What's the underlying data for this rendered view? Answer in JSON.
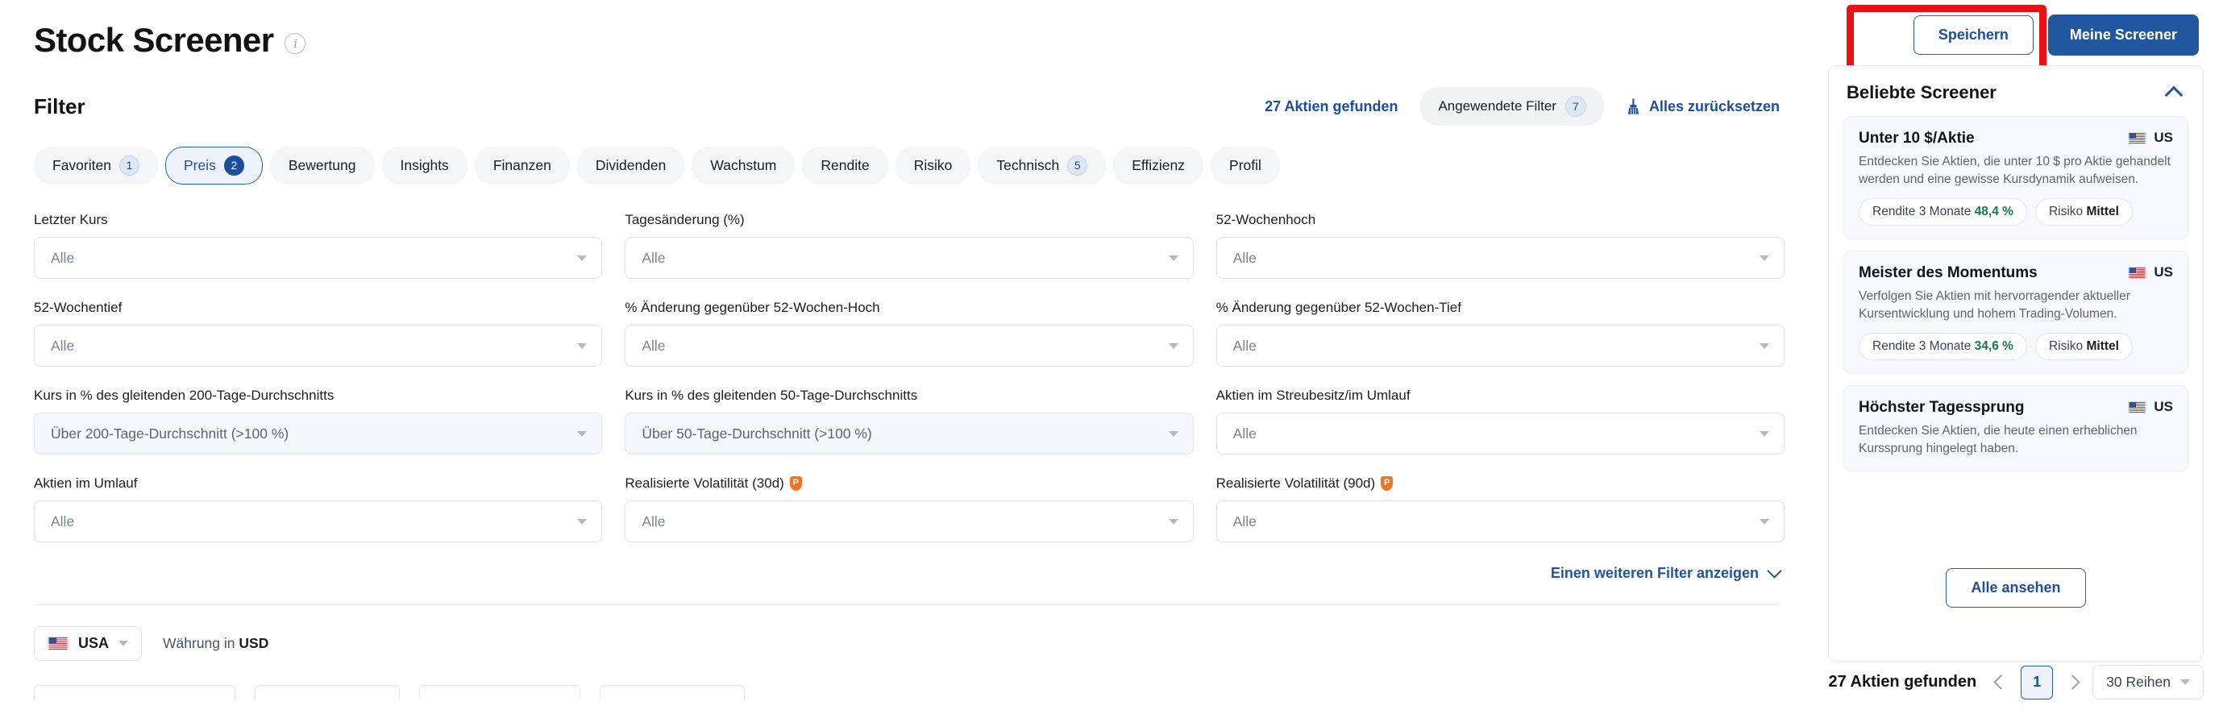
{
  "header": {
    "title": "Stock Screener",
    "info_icon": "info-icon"
  },
  "toolbar": {
    "filter_label": "Filter",
    "found_count": "27 Aktien gefunden",
    "applied_filters_label": "Angewendete Filter",
    "applied_filters_count": "7",
    "reset_label": "Alles zurücksetzen",
    "reset_icon": "broom-icon"
  },
  "tabs": [
    {
      "label": "Favoriten",
      "badge": "1",
      "active": false
    },
    {
      "label": "Preis",
      "badge": "2",
      "active": true
    },
    {
      "label": "Bewertung",
      "badge": "",
      "active": false
    },
    {
      "label": "Insights",
      "badge": "",
      "active": false
    },
    {
      "label": "Finanzen",
      "badge": "",
      "active": false
    },
    {
      "label": "Dividenden",
      "badge": "",
      "active": false
    },
    {
      "label": "Wachstum",
      "badge": "",
      "active": false
    },
    {
      "label": "Rendite",
      "badge": "",
      "active": false
    },
    {
      "label": "Risiko",
      "badge": "",
      "active": false
    },
    {
      "label": "Technisch",
      "badge": "5",
      "active": false
    },
    {
      "label": "Effizienz",
      "badge": "",
      "active": false
    },
    {
      "label": "Profil",
      "badge": "",
      "active": false
    }
  ],
  "filters": [
    {
      "label": "Letzter Kurs",
      "value": "Alle",
      "filled": false,
      "pro": false
    },
    {
      "label": "Tagesänderung (%)",
      "value": "Alle",
      "filled": false,
      "pro": false
    },
    {
      "label": "52-Wochenhoch",
      "value": "Alle",
      "filled": false,
      "pro": false
    },
    {
      "label": "52-Wochentief",
      "value": "Alle",
      "filled": false,
      "pro": false
    },
    {
      "label": "% Änderung gegenüber 52-Wochen-Hoch",
      "value": "Alle",
      "filled": false,
      "pro": false
    },
    {
      "label": "% Änderung gegenüber 52-Wochen-Tief",
      "value": "Alle",
      "filled": false,
      "pro": false
    },
    {
      "label": "Kurs in % des gleitenden 200-Tage-Durchschnitts",
      "value": "Über 200-Tage-Durchschnitt (>100 %)",
      "filled": true,
      "pro": false
    },
    {
      "label": "Kurs in % des gleitenden 50-Tage-Durchschnitts",
      "value": "Über 50-Tage-Durchschnitt (>100 %)",
      "filled": true,
      "pro": false
    },
    {
      "label": "Aktien im Streubesitz/im Umlauf",
      "value": "Alle",
      "filled": false,
      "pro": false
    },
    {
      "label": "Aktien im Umlauf",
      "value": "Alle",
      "filled": false,
      "pro": false
    },
    {
      "label": "Realisierte Volatilität (30d)",
      "value": "Alle",
      "filled": false,
      "pro": true
    },
    {
      "label": "Realisierte Volatilität (90d)",
      "value": "Alle",
      "filled": false,
      "pro": true
    }
  ],
  "show_more": {
    "label": "Einen weiteren Filter anzeigen",
    "icon": "chevron-down-icon"
  },
  "footer": {
    "country": "USA",
    "country_flag": "us-flag-icon",
    "currency_prefix": "Währung in",
    "currency": "USD"
  },
  "sidebar": {
    "save_label": "Speichern",
    "my_screeners_label": "Meine Screener",
    "panel_title": "Beliebte Screener",
    "collapse_icon": "chevron-up-icon",
    "see_all_label": "Alle ansehen",
    "cards": [
      {
        "title": "Unter 10 $/Aktie",
        "region": "US",
        "flag": "us-flag-icon",
        "desc": "Entdecken Sie Aktien, die unter 10 $ pro Aktie gehandelt werden und eine gewisse Kursdynamik aufweisen.",
        "pills": [
          {
            "label": "Rendite 3 Monate",
            "value": "48,4 %",
            "kind": "up"
          },
          {
            "label": "Risiko",
            "value": "Mittel",
            "kind": "plain"
          }
        ]
      },
      {
        "title": "Meister des Momentums",
        "region": "US",
        "flag": "us-flag-icon",
        "desc": "Verfolgen Sie Aktien mit hervorragender aktueller Kursentwicklung und hohem Trading-Volumen.",
        "pills": [
          {
            "label": "Rendite 3 Monate",
            "value": "34,6 %",
            "kind": "up"
          },
          {
            "label": "Risiko",
            "value": "Mittel",
            "kind": "plain"
          }
        ]
      },
      {
        "title": "Höchster Tagessprung",
        "region": "US",
        "flag": "us-flag-icon",
        "desc": "Entdecken Sie Aktien, die heute einen erheblichen Kurssprung hingelegt haben.",
        "pills": []
      }
    ]
  },
  "pagination": {
    "count_label": "27 Aktien gefunden",
    "prev_icon": "chevron-left-icon",
    "next_icon": "chevron-right-icon",
    "current_page": "1",
    "rows_label": "30 Reihen",
    "rows_caret": "chevron-down-icon"
  },
  "colors": {
    "brand_blue": "#21579f",
    "link_blue": "#1c4e9c",
    "up_green": "#16794a",
    "pro_orange": "#f07424",
    "annotation_red": "#ec0f13"
  }
}
